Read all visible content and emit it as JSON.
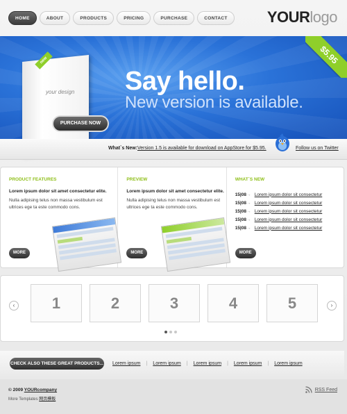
{
  "nav": {
    "items": [
      {
        "label": "HOME",
        "active": true
      },
      {
        "label": "ABOUT"
      },
      {
        "label": "PRODUCTS"
      },
      {
        "label": "PRICING"
      },
      {
        "label": "PURCHASE"
      },
      {
        "label": "CONTACT"
      }
    ]
  },
  "logo": {
    "bold": "YOUR",
    "light": "logo"
  },
  "hero": {
    "title": "Say hello.",
    "subtitle": "New version is available.",
    "price": "$5.95",
    "new_tag": "new",
    "box_label": "your design",
    "purchase_label": "PURCHASE NOW",
    "news_label": "What`s New:",
    "news_link": "Version 1.5 is available for download on AppStore for $5.95.",
    "follow_label": "Follow us on Twitter"
  },
  "features": {
    "col1": {
      "title": "PRODUCT FEATURES",
      "lead": "Lorem ipsum dolor sit amet consectetur elite.",
      "body": "Nulla adipising telus non massa vestibulum est ultrices ege ta este commodo cons.",
      "more": "MORE"
    },
    "col2": {
      "title": "PREVIEW",
      "lead": "Lorem ipsum dolor sit amet consectetur elite.",
      "body": "Nulla adipising telus non massa vestibulum est ultrices ege ta este commodo cons.",
      "more": "MORE"
    },
    "col3": {
      "title": "WHAT`S NEW",
      "items": [
        {
          "date": "15|08",
          "text": "Lorem ipsum dolor sit consectetur"
        },
        {
          "date": "15|08",
          "text": "Lorem ipsum dolor sit consectetur"
        },
        {
          "date": "15|08",
          "text": "Lorem ipsum dolor sit consectetur"
        },
        {
          "date": "15|08",
          "text": "Lorem ipsum dolor sit consectetur"
        },
        {
          "date": "15|08",
          "text": "Lorem ipsum dolor sit consectetur"
        }
      ],
      "more": "MORE"
    }
  },
  "carousel": {
    "slides": [
      "1",
      "2",
      "3",
      "4",
      "5"
    ],
    "left_arrow": "‹",
    "right_arrow": "›"
  },
  "bottom": {
    "check_label": "CHECK ALSO THESE GREAT PRODUCTS...",
    "links": [
      "Lorem ipsum",
      "Lorem ipsum",
      "Lorem ipsum",
      "Lorem ipsum",
      "Lorem ipsum"
    ],
    "separator": "|"
  },
  "footer": {
    "copy_prefix": "© 2009",
    "copy_company": "YOURcompany",
    "more_prefix": "More Templates",
    "more_link": "网页模板",
    "rss": "RSS Feed"
  }
}
